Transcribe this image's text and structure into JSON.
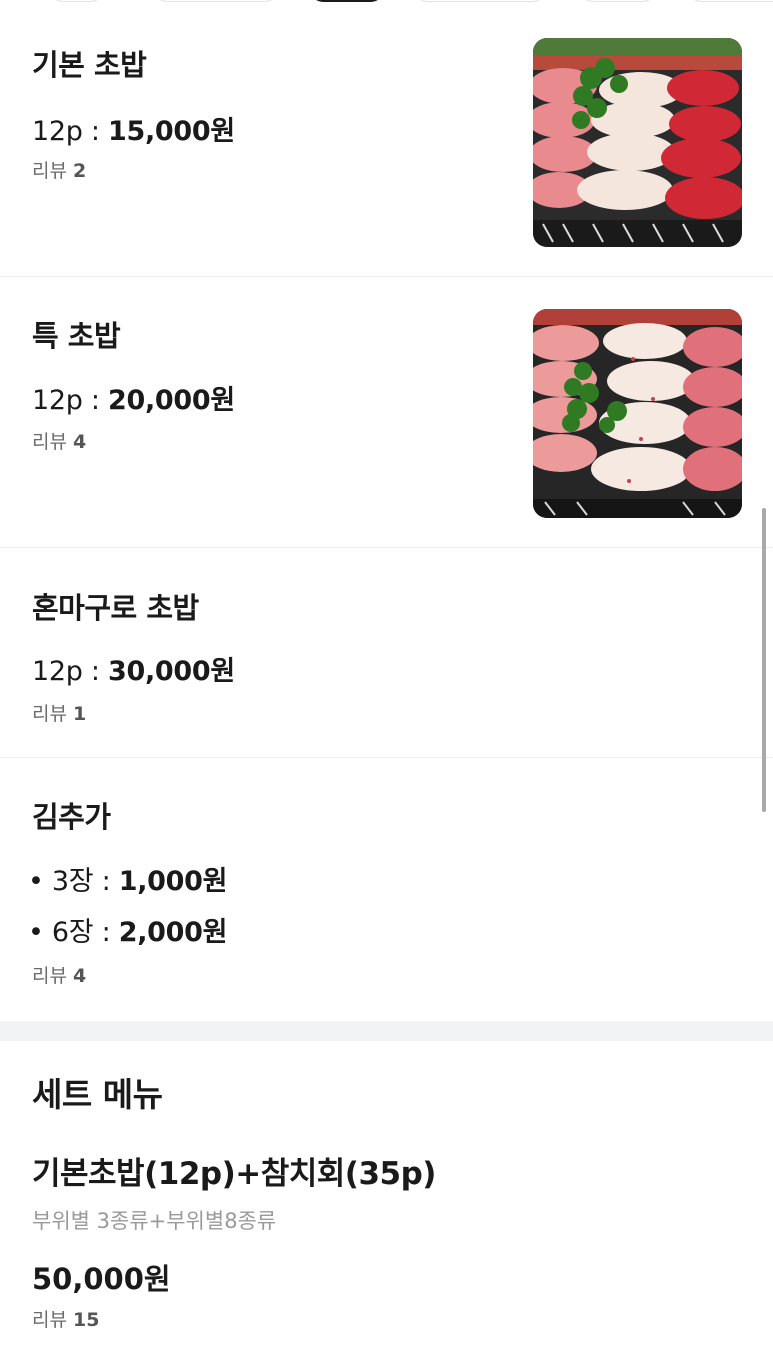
{
  "menu": [
    {
      "title": "기본 초밥",
      "price_prefix": "12p : ",
      "price": "15,000원",
      "review_label": "리뷰 ",
      "review_count": "2",
      "has_image": true
    },
    {
      "title": "특 초밥",
      "price_prefix": "12p : ",
      "price": "20,000원",
      "review_label": "리뷰 ",
      "review_count": "4",
      "has_image": true
    },
    {
      "title": "혼마구로 초밥",
      "price_prefix": "12p : ",
      "price": "30,000원",
      "review_label": "리뷰 ",
      "review_count": "1",
      "has_image": false
    },
    {
      "title": "김추가",
      "options": [
        {
          "prefix": "• 3장 : ",
          "price": "1,000원"
        },
        {
          "prefix": "• 6장 : ",
          "price": "2,000원"
        }
      ],
      "review_label": "리뷰 ",
      "review_count": "4",
      "has_image": false
    }
  ],
  "set_menu": {
    "section_title": "세트 메뉴",
    "item": {
      "title": "기본초밥(12p)+참치회(35p)",
      "description": "부위별 3종류+부위별8종류",
      "price": "50,000원",
      "review_label": "리뷰 ",
      "review_count": "15"
    }
  },
  "icons": {
    "food_photo_1": "sushi-photo",
    "food_photo_2": "sushi-photo"
  },
  "colors": {
    "divider": "#eeeeee",
    "section_gap": "#f2f3f5",
    "muted_text": "#9a9a9a"
  }
}
